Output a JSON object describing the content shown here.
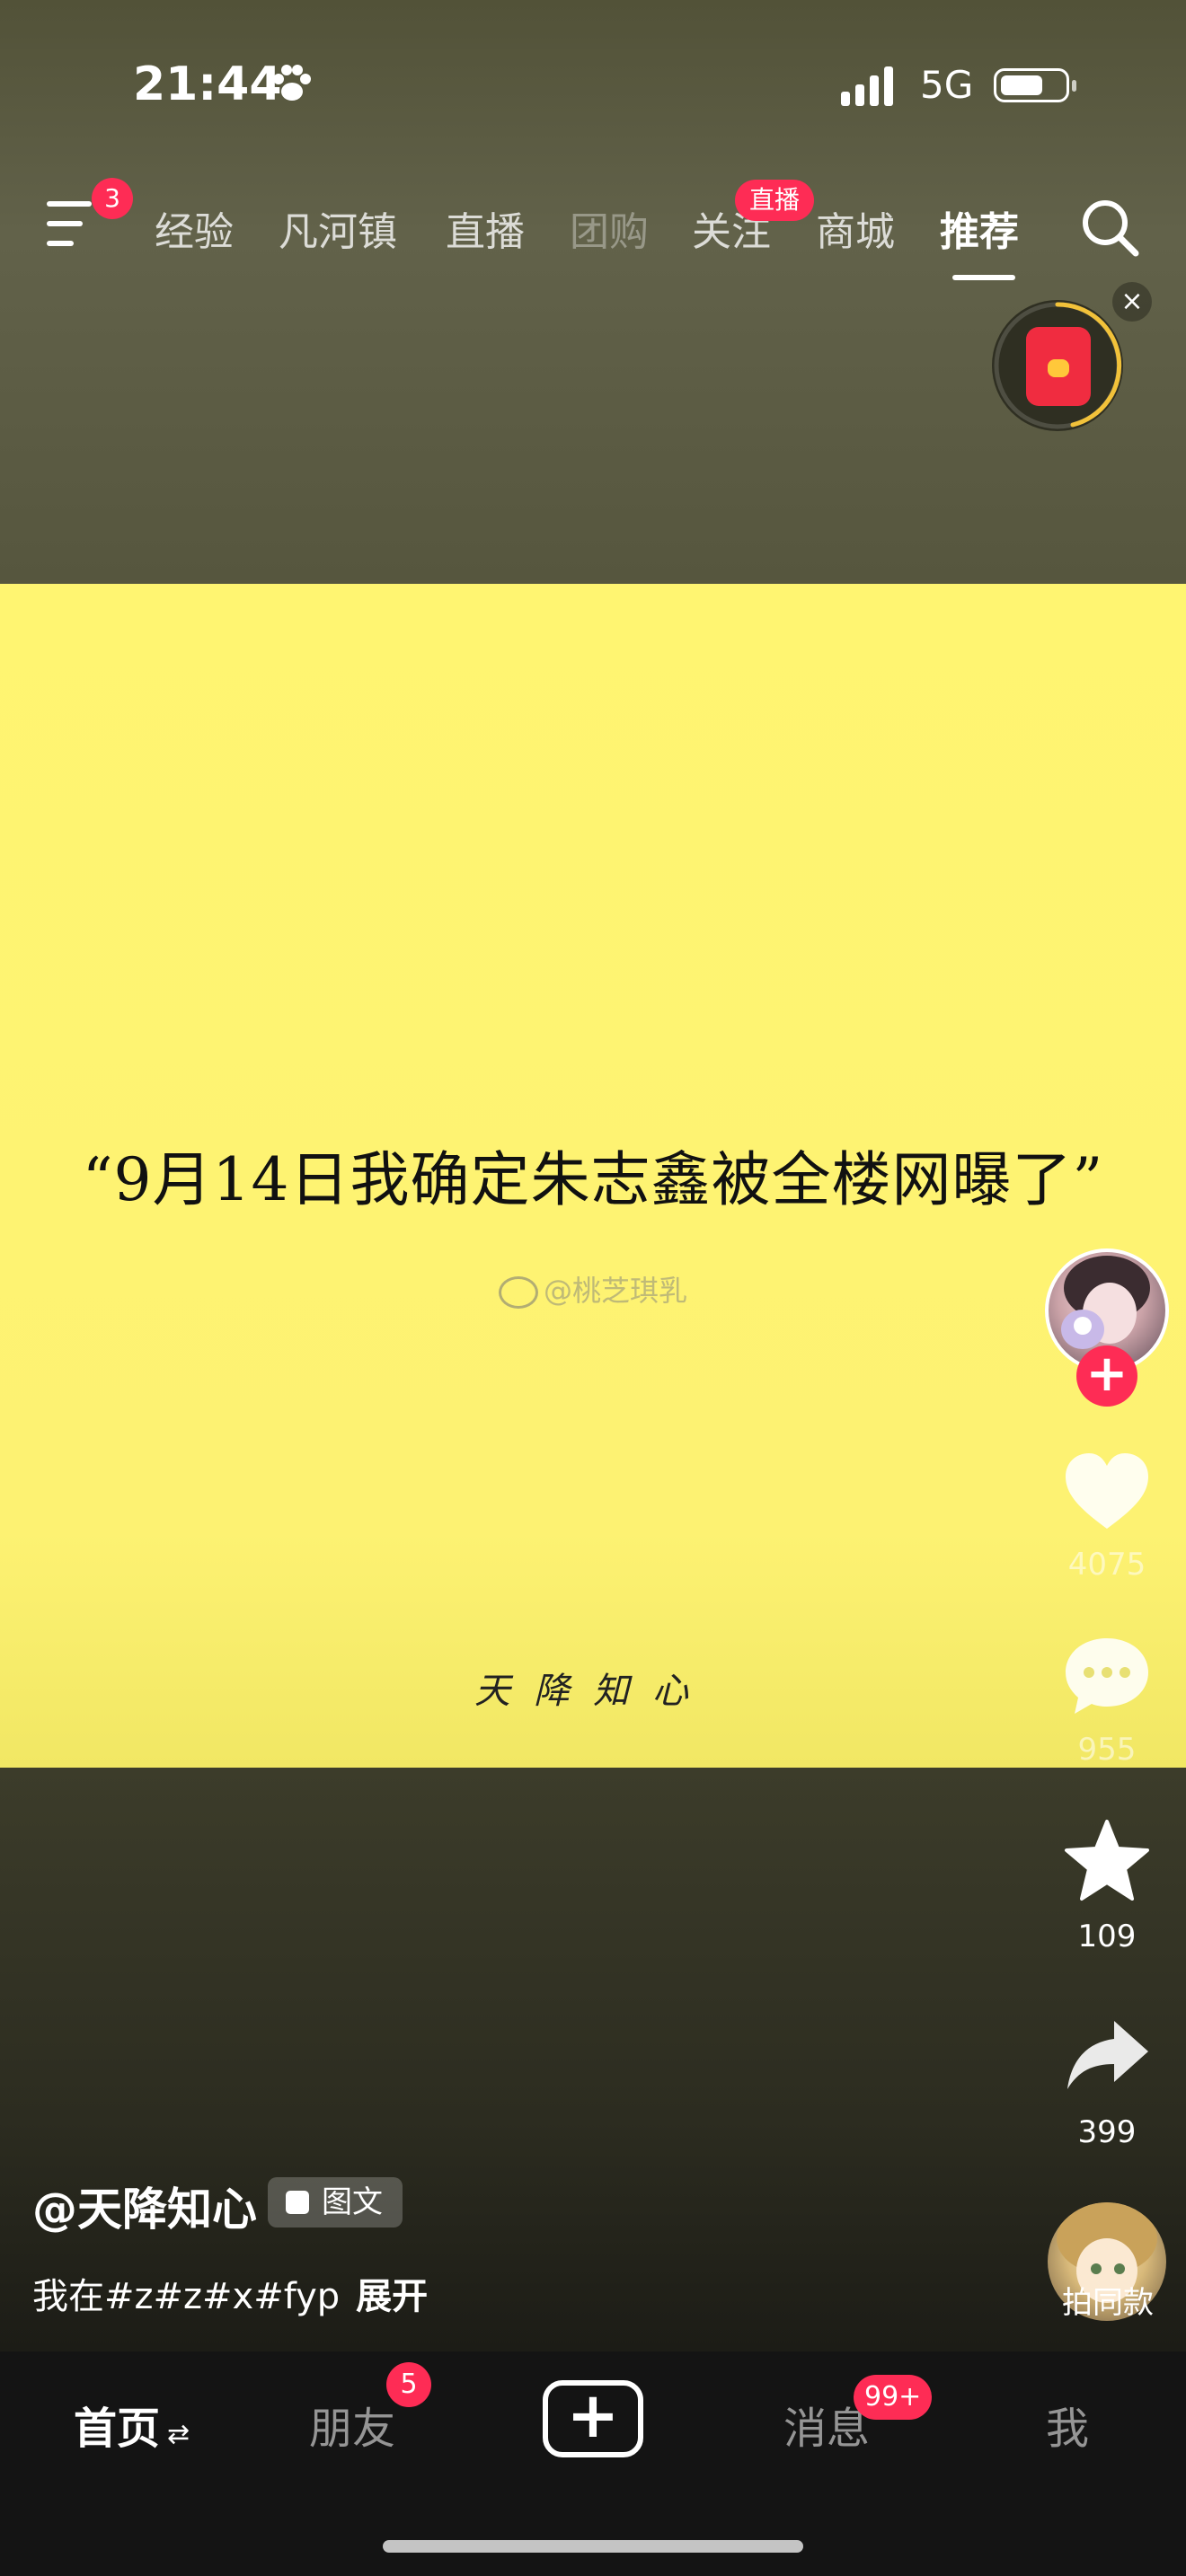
{
  "status_bar": {
    "time": "21:44",
    "network": "5G"
  },
  "top_nav": {
    "menu_badge": "3",
    "tabs": [
      "经验",
      "凡河镇",
      "直播",
      "团购",
      "关注",
      "商城",
      "推荐"
    ],
    "active_tab": "推荐",
    "live_badge": "直播"
  },
  "post": {
    "quote": "“9月14日我确定朱志鑫被全楼网曝了”",
    "watermark": "@桃芝琪乳",
    "signature": "天降知心",
    "author": "@天降知心",
    "post_type": "图文",
    "description": "我在#z#z#x#fyp",
    "expand": "展开"
  },
  "right_rail": {
    "likes": "4075",
    "comments": "955",
    "favorites": "109",
    "shares": "399",
    "same_style": "拍同款"
  },
  "bottom_nav": {
    "home": "首页",
    "friends": "朋友",
    "friends_badge": "5",
    "messages": "消息",
    "messages_badge": "99+",
    "me": "我"
  },
  "colors": {
    "accent": "#fe2c55",
    "photo_yellow": "#fff571"
  }
}
